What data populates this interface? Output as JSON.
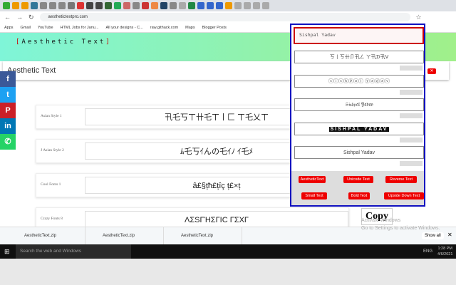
{
  "browser": {
    "url": "aesthetictextpro.com",
    "bookmarks": [
      "Apps",
      "Gmail",
      "YouTube",
      "HTML Jobs for Janu...",
      "All your designs - C...",
      "raw.githack.com",
      "Maps",
      "Blogger Posts"
    ],
    "new_tab": "+"
  },
  "header": {
    "logo_bracket_open": "[",
    "logo": "Aesthetic Text",
    "logo_bracket_close": "]",
    "page_title": "Aesthetic Text"
  },
  "social": [
    {
      "name": "facebook",
      "glyph": "f",
      "color": "#3b5998"
    },
    {
      "name": "twitter",
      "glyph": "t",
      "color": "#1da1f2"
    },
    {
      "name": "pinterest",
      "glyph": "P",
      "color": "#cb2027"
    },
    {
      "name": "linkedin",
      "glyph": "in",
      "color": "#0077b5"
    },
    {
      "name": "whatsapp",
      "glyph": "✆",
      "color": "#25d366"
    }
  ],
  "styles": [
    {
      "label": "Asian Style 1",
      "value": "卂乇丂ㄒ卄乇ㄒ丨匚 ㄒ乇乂ㄒ"
    },
    {
      "label": "J Asian Style 2",
      "value": "ﾑ乇丂ｲんの乇ｲﾉ ｲ乇ﾒ"
    },
    {
      "label": "Cool Fonts 1",
      "value": "â£§țħ£țîç ț£×ț"
    },
    {
      "label": "Crazy Fonts 8",
      "value": "ΛΣSΓΉΣΓIC ΓΣXΓ"
    }
  ],
  "copy_label": "Copy",
  "watermark": {
    "line1": "Activate Windows",
    "line2": "Go to Settings to activate Windows."
  },
  "popup": {
    "input": "Sishpal Yadav",
    "outputs": [
      "ㄎ丨ㄎ卄卩卂ㄥ ㄚ卂ᗪ卂ᐯ",
      "ⓢⓘⓢⓗⓟⓐⓛ ⓨⓐⓓⓐⓥ",
      "𝔖𝔦𝔰𝔥𝔭𝔞𝔩 𝔜𝔞𝔡𝔞𝔳",
      "SISHPAL YADAV",
      "Sishpal Yadav"
    ],
    "buttons": [
      "AestheticText",
      "Unicode Text",
      "Reverse Text",
      "Small Text",
      "Bold Text",
      "Upside Down Text"
    ]
  },
  "downloads": {
    "files": [
      "AestheticText.zip",
      "AestheticText.zip",
      "AestheticText.zip"
    ],
    "show_all": "Show all"
  },
  "taskbar": {
    "search": "Search the web and Windows",
    "lang": "ENG",
    "time": "1:28 PM",
    "date": "4/6/2021"
  }
}
